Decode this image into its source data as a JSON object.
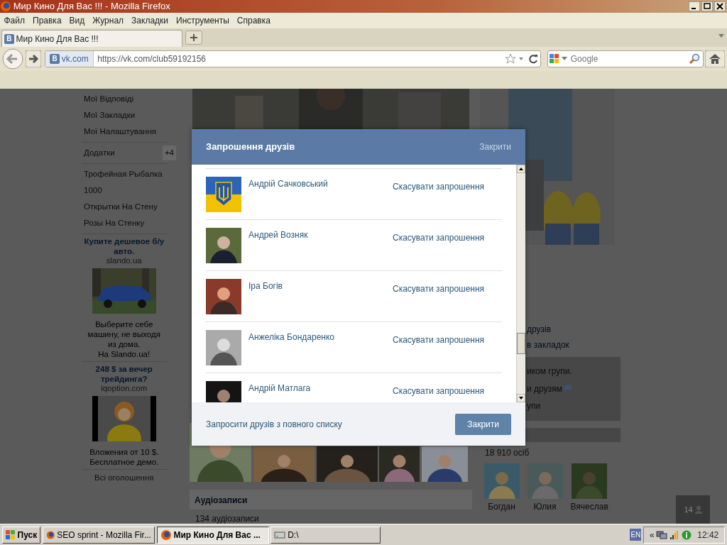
{
  "window": {
    "title": "Мир Кино Для Вас !!! - Mozilla Firefox"
  },
  "menu": [
    "Файл",
    "Правка",
    "Вид",
    "Журнал",
    "Закладки",
    "Инструменты",
    "Справка"
  ],
  "tabs": [
    {
      "label": "Мир Кино Для Вас !!!",
      "icon_text": "B",
      "selected": true
    }
  ],
  "address_bar": {
    "icon_text": "B",
    "site": "vk.com",
    "url": "https://vk.com/club59192156"
  },
  "search": {
    "placeholder": "Google"
  },
  "sidebar": {
    "items": [
      {
        "label": "Мої Відповіді"
      },
      {
        "label": "Мої Закладки"
      },
      {
        "label": "Мої Налаштування"
      }
    ],
    "apps_label": "Додатки",
    "apps_badge": "+4",
    "apps": [
      {
        "label": "Трофейная Рыбалка"
      },
      {
        "label": "1000"
      },
      {
        "label": "Открытки На Стену"
      },
      {
        "label": "Розы На Стенку"
      }
    ]
  },
  "ads": [
    {
      "title": "Купите дешевое б/у авто.",
      "domain": "slando.ua",
      "kind": "car",
      "text": "Выберите себе\nмашину, не выходя\nиз дома.\nНа Slando.ua!"
    },
    {
      "title": "248 $ за вечер трейдинга?",
      "domain": "iqoption.com",
      "kind": "figure",
      "text": "Вложения от 10 $.\nБесплатное демо."
    }
  ],
  "all_ads": "Всі оголошення",
  "group_links": [
    "друзів",
    "в закладок"
  ],
  "group_info": [
    "иком групи.",
    "и друзям",
    "упи"
  ],
  "members": {
    "count": "18 910 осіб",
    "people": [
      {
        "name": "Богдан"
      },
      {
        "name": "Юлия"
      },
      {
        "name": "Вячеслав"
      }
    ]
  },
  "audio": {
    "title": "Аудіозаписи",
    "count": "134 аудіозаписи"
  },
  "dialog": {
    "title": "Запрошення друзів",
    "close_link": "Закрити",
    "rows": [
      {
        "name": "Андрій Сачковський",
        "kind": "flag",
        "action": "Скасувати запрошення"
      },
      {
        "name": "Андрей Возняк",
        "action": "Скасувати запрошення"
      },
      {
        "name": "Іра Богів",
        "action": "Скасувати запрошення"
      },
      {
        "name": "Анжеліка Бондаренко",
        "action": "Скасувати запрошення"
      },
      {
        "name": "Андрій Матлага",
        "action": "Скасувати запрошення"
      }
    ],
    "footer_link": "Запросити друзів з повного списку",
    "close_button": "Закрити"
  },
  "online_counter": "14",
  "taskbar": {
    "start": "Пуск",
    "tasks": [
      {
        "label": "SEO sprint - Mozilla Fir...",
        "kind": "browser",
        "selected": false
      },
      {
        "label": "Мир Кино Для Вас ...",
        "kind": "browser",
        "selected": true
      },
      {
        "label": "D:\\",
        "kind": "drive",
        "selected": false
      }
    ],
    "lang": "EN",
    "tray_arrow": "«",
    "clock": "12:42"
  }
}
